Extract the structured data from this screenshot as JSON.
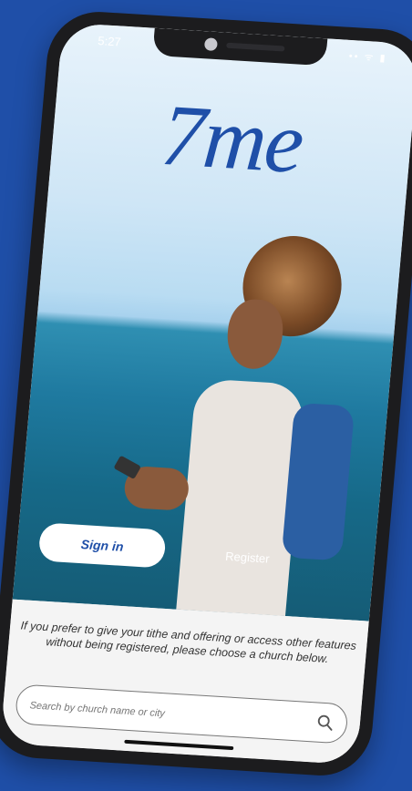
{
  "status_bar": {
    "time": "5:27",
    "icons": "•• ᯤ ▮"
  },
  "logo": {
    "text": "7me"
  },
  "auth": {
    "signin_label": "Sign in",
    "register_label": "Register"
  },
  "guest": {
    "info_text": "If you prefer to give your tithe and offering or access other features without being registered, please choose a church below."
  },
  "search": {
    "placeholder": "Search by church name or city",
    "icon": "search-icon"
  },
  "colors": {
    "brand": "#1f4fa8",
    "background": "#1f4fa8"
  }
}
